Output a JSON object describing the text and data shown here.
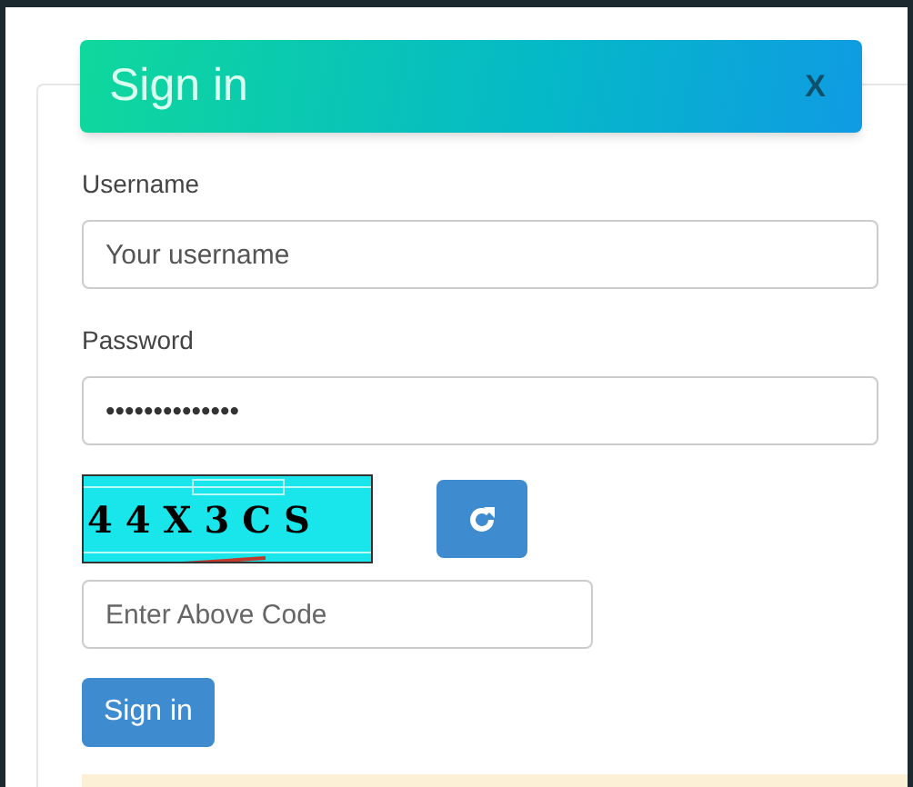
{
  "dialog": {
    "title": "Sign in",
    "close": "X"
  },
  "fields": [
    {
      "label": "Username",
      "placeholder": "Your username"
    },
    {
      "label": "Password",
      "value": "••••••••••••••"
    }
  ],
  "captcha": {
    "code": "4 4 X 3 C S"
  },
  "code_field": {
    "placeholder": "Enter Above Code"
  },
  "submit": "Sign in"
}
